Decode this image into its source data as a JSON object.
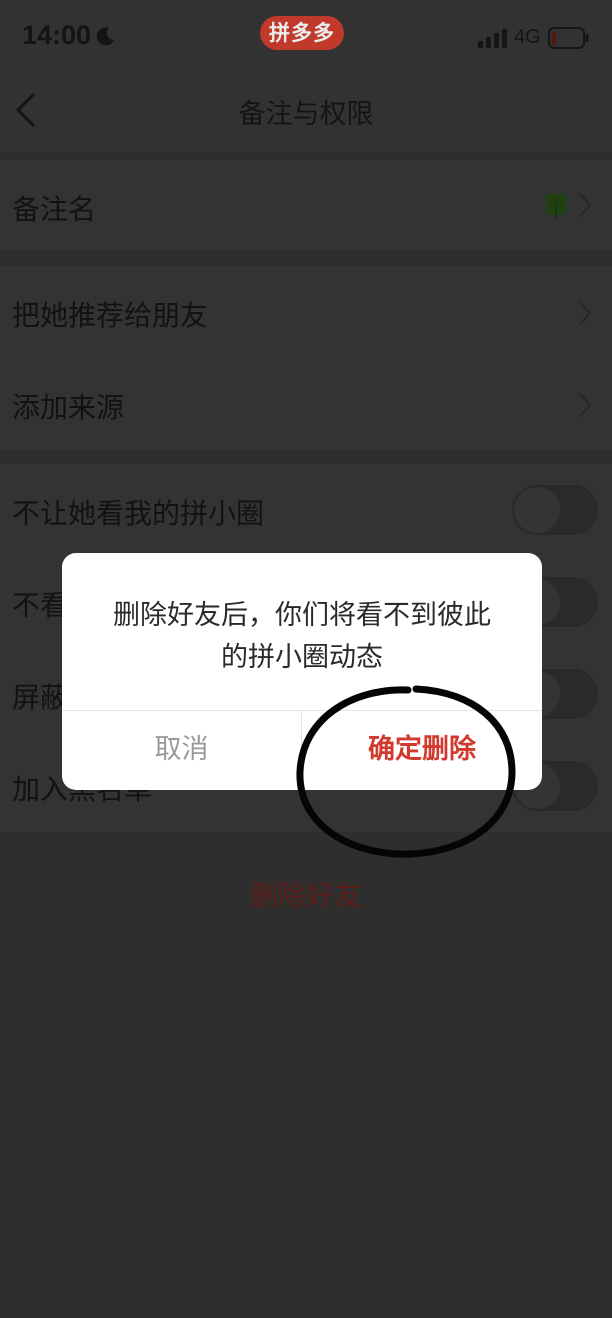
{
  "status_bar": {
    "time": "14:00",
    "app_badge": "拼多多",
    "network": "4G",
    "icons": [
      "moon-icon",
      "signal-icon",
      "battery-icon"
    ]
  },
  "nav": {
    "title": "备注与权限",
    "back_icon": "chevron-left-icon"
  },
  "rows": [
    {
      "label": "备注名",
      "accessory": "chevron",
      "extra_icon": "clover-icon"
    },
    {
      "label": "把她推荐给朋友",
      "accessory": "chevron"
    },
    {
      "label": "添加来源",
      "accessory": "chevron"
    },
    {
      "label": "不让她看我的拼小圈",
      "accessory": "toggle",
      "on": false
    },
    {
      "label": "不看",
      "accessory": "toggle",
      "on": false
    },
    {
      "label": "屏蔽",
      "accessory": "toggle",
      "on": false
    },
    {
      "label": "加入黑名单",
      "accessory": "toggle",
      "on": false
    }
  ],
  "delete_friend_label": "删除好友",
  "dialog": {
    "message_line1": "删除好友后，你们将看不到彼此",
    "message_line2": "的拼小圈动态",
    "cancel_label": "取消",
    "confirm_label": "确定删除"
  },
  "colors": {
    "accent_red": "#d23a2f",
    "badge_red": "#c0392b",
    "overlay_bg": "#2e2e2e",
    "dialog_bg": "#ffffff"
  }
}
